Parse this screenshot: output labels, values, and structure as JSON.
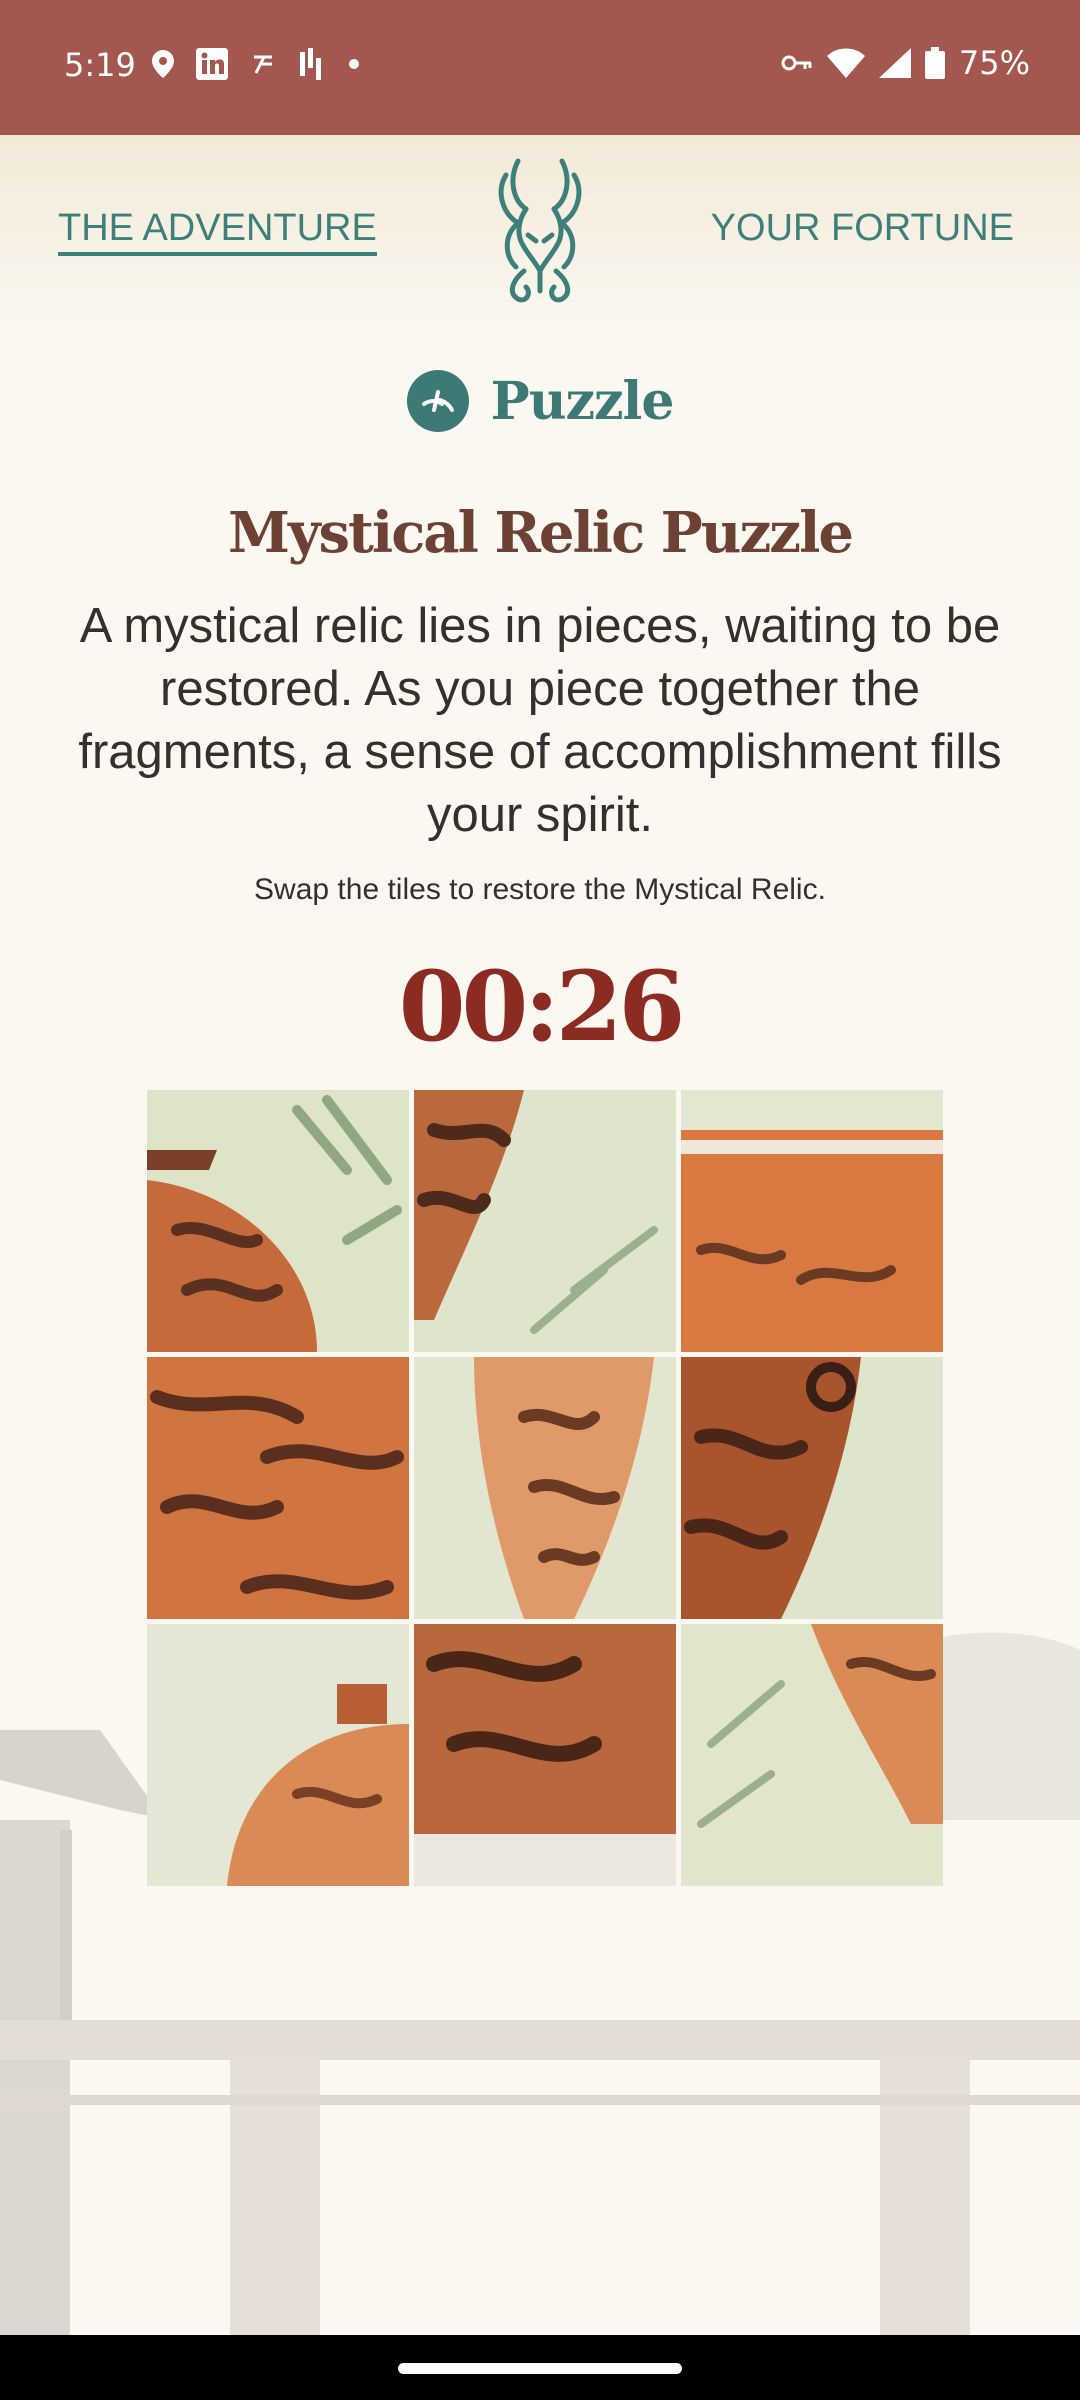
{
  "status_bar": {
    "time": "5:19",
    "battery": "75%",
    "icons_left": [
      "location-icon",
      "linkedin-icon",
      "app-icon",
      "podcast-icon",
      "dot-icon"
    ],
    "icons_right": [
      "vpn-key-icon",
      "wifi-icon",
      "signal-icon",
      "battery-icon"
    ]
  },
  "header": {
    "nav_left": "THE ADVENTURE",
    "nav_right": "YOUR FORTUNE",
    "logo_icon": "dragon-logo-icon"
  },
  "section": {
    "icon": "puzzle-icon",
    "title": "Puzzle"
  },
  "puzzle": {
    "title": "Mystical Relic Puzzle",
    "description": "A mystical relic lies in pieces, waiting to be restored. As you piece together the fragments, a sense of accomplishment fills your spirit.",
    "instruction": "Swap the tiles to restore the Mystical Relic.",
    "timer": "00:26",
    "tiles": [
      "tile-1",
      "tile-2",
      "tile-3",
      "tile-4",
      "tile-5",
      "tile-6",
      "tile-7",
      "tile-8",
      "tile-9"
    ]
  },
  "colors": {
    "status_bar": "#a3574f",
    "teal": "#3d7a76",
    "title_brown": "#6d4234",
    "timer_red": "#8c2b22",
    "background": "#fbf8f1"
  }
}
